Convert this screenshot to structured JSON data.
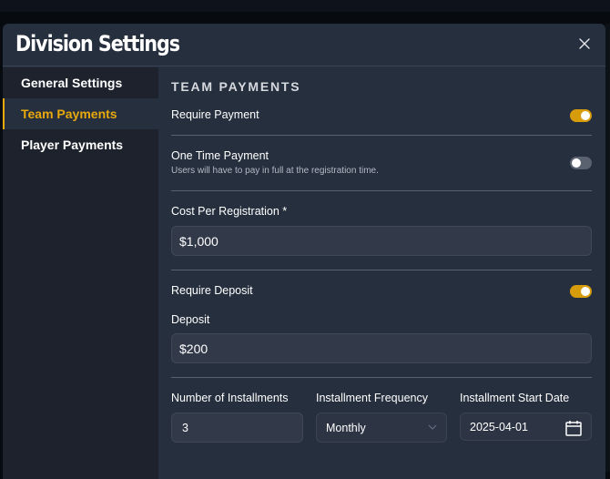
{
  "modal": {
    "title": "Division Settings",
    "close_icon": "close-icon"
  },
  "sidebar": {
    "items": [
      {
        "label": "General Settings",
        "active": false
      },
      {
        "label": "Team Payments",
        "active": true
      },
      {
        "label": "Player Payments",
        "active": false
      }
    ]
  },
  "content": {
    "section_title": "TEAM PAYMENTS",
    "require_payment": {
      "label": "Require Payment",
      "enabled": true
    },
    "one_time_payment": {
      "label": "One Time Payment",
      "description": "Users will have to pay in full at the registration time.",
      "enabled": false
    },
    "cost_per_registration": {
      "label": "Cost Per Registration *",
      "value": "$1,000"
    },
    "require_deposit": {
      "label": "Require Deposit",
      "enabled": true
    },
    "deposit": {
      "label": "Deposit",
      "value": "$200"
    },
    "installments": {
      "count_label": "Number of Installments",
      "count_value": "3",
      "frequency_label": "Installment Frequency",
      "frequency_value": "Monthly",
      "start_date_label": "Installment Start Date",
      "start_date_value": "2025-04-01"
    }
  },
  "colors": {
    "accent": "#e8a90c",
    "toggle_on": "#d79c0c",
    "toggle_off": "#5a6270",
    "modal_bg": "#262f3e",
    "sidebar_bg": "#1d222c"
  }
}
